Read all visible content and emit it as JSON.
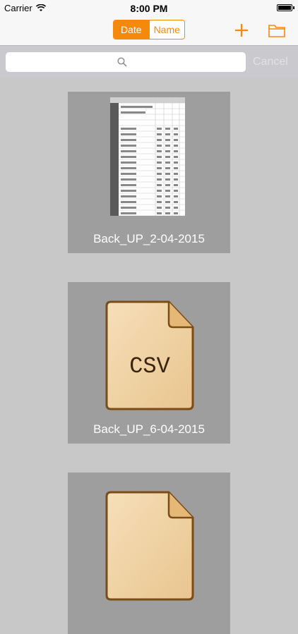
{
  "status_bar": {
    "carrier": "Carrier",
    "time": "8:00 PM"
  },
  "nav": {
    "sort_options": [
      "Date",
      "Name"
    ],
    "selected_sort": "Date"
  },
  "search": {
    "placeholder": "",
    "cancel_label": "Cancel"
  },
  "files": [
    {
      "name": "Back_UP_2-04-2015",
      "thumbnail": "spreadsheet-preview"
    },
    {
      "name": "Back_UP_6-04-2015",
      "thumbnail": "csv-file-icon",
      "icon_text": "CSV"
    },
    {
      "name": "",
      "thumbnail": "csv-file-icon"
    }
  ],
  "colors": {
    "accent": "#f5890c",
    "tile_bg": "#9e9e9e",
    "background": "#c8c8c8"
  }
}
